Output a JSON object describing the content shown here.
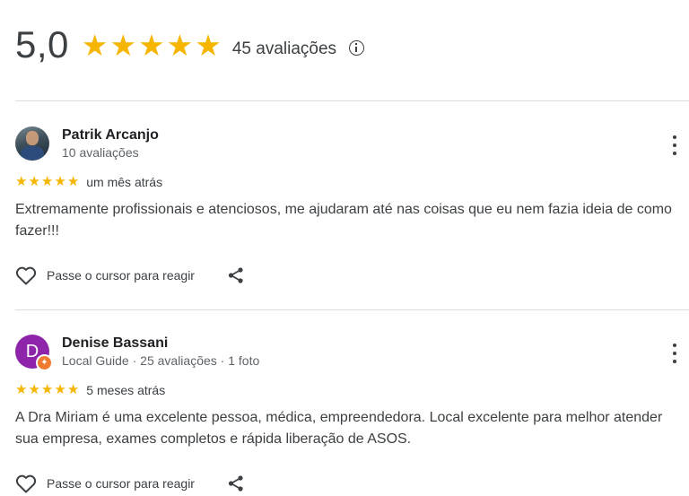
{
  "summary": {
    "rating": "5,0",
    "stars": [
      "★",
      "★",
      "★",
      "★",
      "★"
    ],
    "count": "45 avaliações",
    "info_icon": "info-icon",
    "star_color": "#f6b500"
  },
  "reviews": [
    {
      "name": "Patrik Arcanjo",
      "meta": "10 avaliações",
      "avatar": "photo",
      "stars": [
        "★",
        "★",
        "★",
        "★",
        "★"
      ],
      "time": "um mês atrás",
      "text": "Extremamente profissionais e atenciosos, me ajudaram até nas coisas que eu nem fazia ideia de como fazer!!!",
      "react_label": "Passe o cursor para reagir"
    },
    {
      "name": "Denise Bassani",
      "meta": "Local Guide · 25 avaliações · 1 foto",
      "avatar_letter": "D",
      "avatar_color": "#8e24aa",
      "badge_icon": "local-guide-star-icon",
      "badge_glyph": "✦",
      "stars": [
        "★",
        "★",
        "★",
        "★",
        "★"
      ],
      "time": "5 meses atrás",
      "text": "A Dra Miriam é uma excelente pessoa, médica, empreendedora. Local excelente para melhor atender sua empresa, exames completos e rápida liberação de ASOS.",
      "react_label": "Passe o cursor para reagir"
    }
  ]
}
